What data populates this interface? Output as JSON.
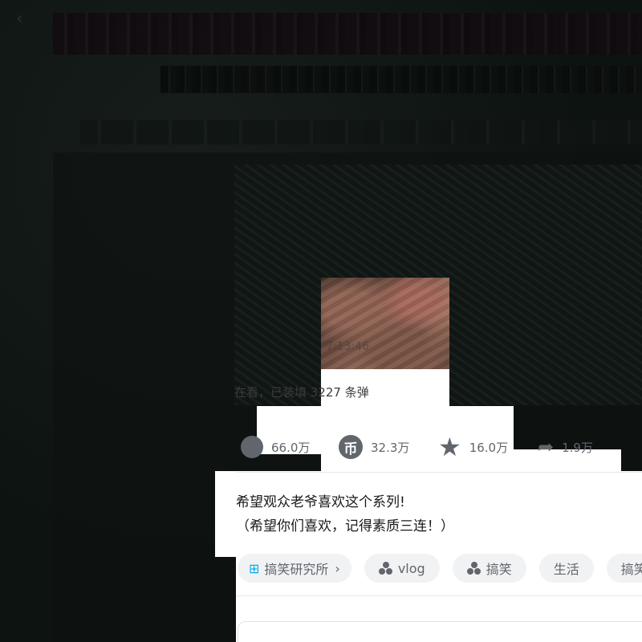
{
  "player": {
    "duration": "7:13:46",
    "viewers_text": "在看，已装填 3227 条弹"
  },
  "actions": {
    "like": "66.0万",
    "coin": "32.3万",
    "favorite": "16.0万",
    "share": "1.9万",
    "coin_glyph": "币"
  },
  "description": {
    "line1": "希望观众老爷喜欢这个系列!",
    "line2": "（希望你们喜欢，记得素质三连！）"
  },
  "tags": {
    "topic": "搞笑研究所",
    "items": [
      "vlog",
      "搞笑",
      "生活",
      "搞笑"
    ]
  },
  "icons": {
    "back": "back-arrow-icon",
    "topic": "topic-hash-icon",
    "channel": "channel-dots-icon",
    "like": "thumb-up-icon",
    "coin": "coin-icon",
    "favorite": "star-icon",
    "share": "share-icon"
  },
  "colors": {
    "topic_accent": "#00aeec",
    "icon_gray": "#61666d",
    "tag_bg": "#f1f2f3"
  }
}
